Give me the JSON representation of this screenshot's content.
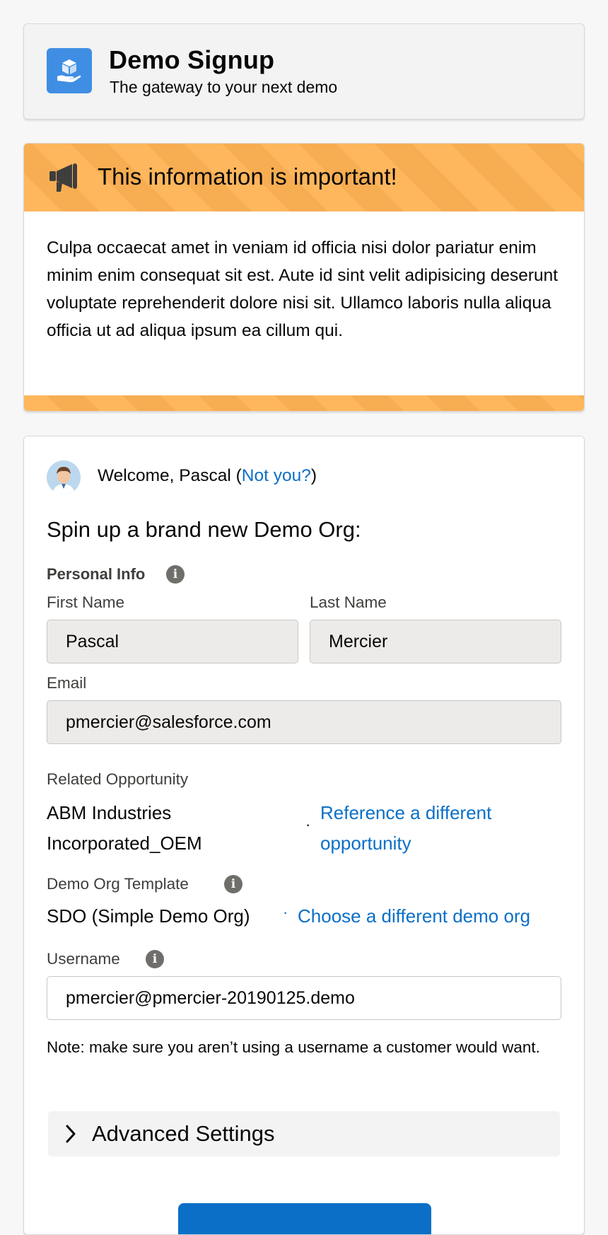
{
  "header": {
    "title": "Demo Signup",
    "subtitle": "The gateway to your next demo",
    "icon": "box-in-hand-icon",
    "accent": "#3f8ee3"
  },
  "alert": {
    "title": "This information is important!",
    "body": "Culpa occaecat amet in veniam id officia nisi dolor pariatur enim minim enim consequat sit est. Aute id sint velit adipisicing deserunt voluptate reprehenderit dolore nisi sit. Ullamco laboris nulla aliqua officia ut ad aliqua ipsum ea cillum qui.",
    "icon": "megaphone-icon",
    "color": "#ffb75d"
  },
  "user": {
    "welcome_prefix": "Welcome, Pascal (",
    "not_you": "Not you?",
    "welcome_suffix": ")"
  },
  "form": {
    "heading": "Spin up a brand new Demo Org:",
    "personal_info_label": "Personal Info",
    "first_name_label": "First Name",
    "first_name_value": "Pascal",
    "last_name_label": "Last Name",
    "last_name_value": "Mercier",
    "email_label": "Email",
    "email_value": "pmercier@salesforce.com",
    "related_opportunity_label": "Related Opportunity",
    "related_opportunity_value": "ABM Industries Incorporated_OEM",
    "reference_link": "Reference a different opportunity",
    "template_label": "Demo Org Template",
    "template_value": "SDO (Simple Demo Org)",
    "template_link": "Choose a different demo org",
    "username_label": "Username",
    "username_value": "pmercier@pmercier-20190125.demo",
    "note": "Note: make sure you aren’t using a username a customer would want.",
    "advanced_label": "Advanced Settings"
  },
  "colors": {
    "link": "#0b6fc8",
    "brand_button": "#0b6fc8"
  }
}
